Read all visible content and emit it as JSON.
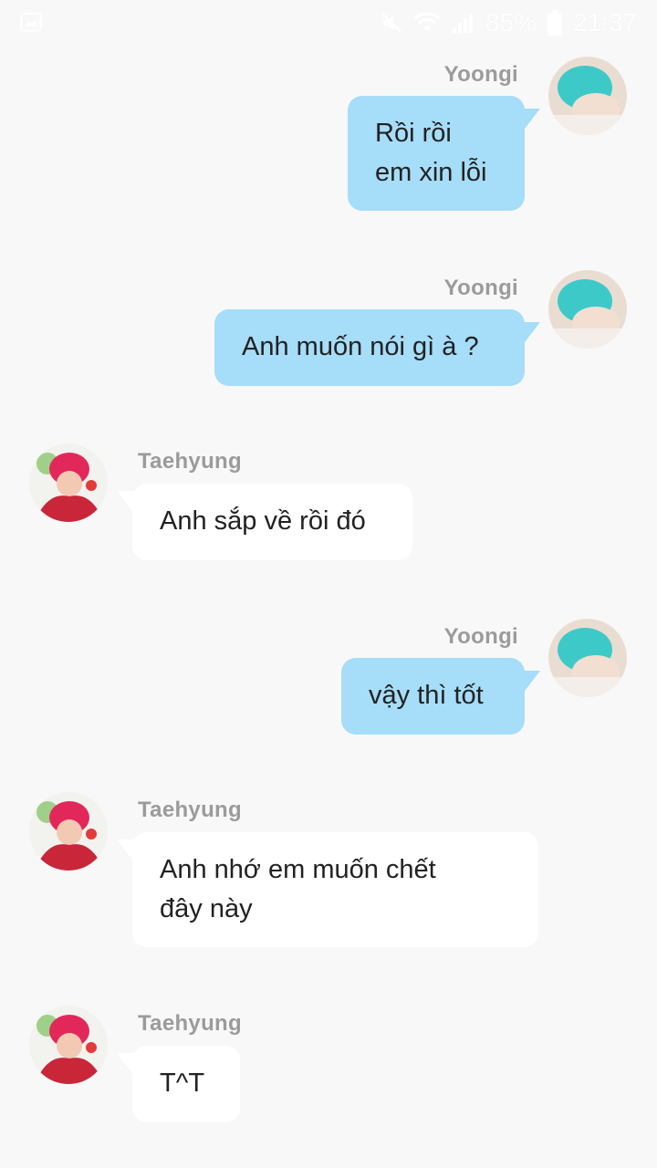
{
  "status_bar": {
    "battery_percent": "85%",
    "time": "21:37",
    "icons": [
      "image-icon",
      "mute-icon",
      "wifi-icon",
      "signal-icon",
      "battery-icon"
    ]
  },
  "messages": [
    {
      "side": "out",
      "sender": "Yoongi",
      "lines": [
        "Rồi rồi",
        "em xin lỗi"
      ]
    },
    {
      "side": "out",
      "sender": "Yoongi",
      "lines": [
        "Anh muốn nói gì à ?"
      ]
    },
    {
      "side": "in",
      "sender": "Taehyung",
      "lines": [
        "Anh sắp về rồi đó"
      ]
    },
    {
      "side": "out",
      "sender": "Yoongi",
      "lines": [
        "vậy thì tốt"
      ]
    },
    {
      "side": "in",
      "sender": "Taehyung",
      "lines": [
        "Anh nhớ em muốn chết",
        "đây này"
      ]
    },
    {
      "side": "in",
      "sender": "Taehyung",
      "lines": [
        "T^T"
      ]
    }
  ],
  "colors": {
    "background": "#f8f8f8",
    "outgoing_bubble": "#a6ddf8",
    "incoming_bubble": "#ffffff",
    "sender_name": "#9b9b9b",
    "message_text": "#222222"
  }
}
